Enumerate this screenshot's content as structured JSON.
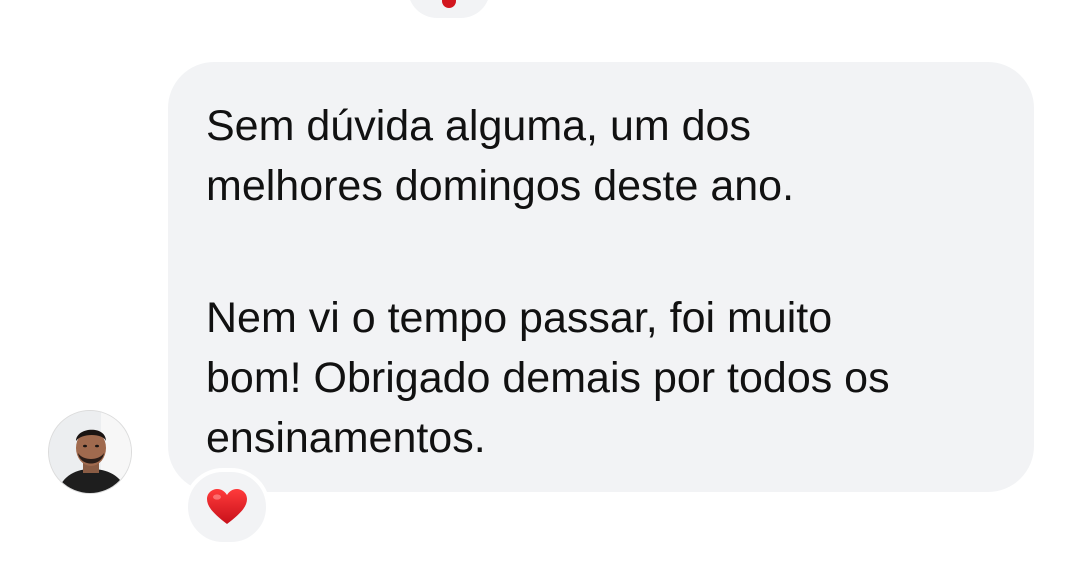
{
  "thread": {
    "message": {
      "paragraphs": [
        "Sem dúvida alguma, um dos\nmelhores domingos deste ano.",
        "Nem vi o tempo passar, foi muito\nbom! Obrigado demais por todos os\nensinamentos."
      ],
      "reaction": {
        "icon": "heart-icon",
        "color": "#d2161e"
      }
    },
    "previous_reaction": {
      "icon": "heart-icon"
    },
    "colors": {
      "bubble": "#f2f3f5",
      "text": "#111111",
      "heart": "#d2161e"
    }
  }
}
